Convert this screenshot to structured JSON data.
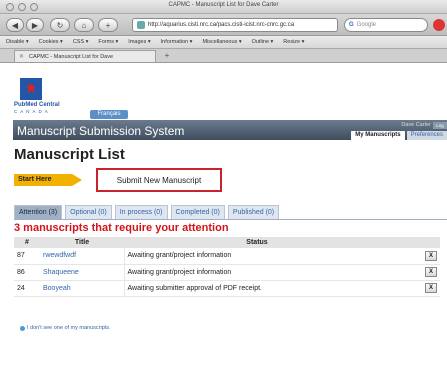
{
  "window": {
    "title": "CAPMC - Manuscript List for Dave Carter"
  },
  "toolbar": {
    "back_glyph": "◀",
    "forward_glyph": "▶",
    "reload_glyph": "↻",
    "home_glyph": "⌂",
    "add_glyph": "+",
    "url": "http://aquarius.cisti.nrc.ca/pacs.cisti-icist.nrc-cnrc.gc.ca",
    "search_placeholder": "Google",
    "search_logo": "G"
  },
  "bookmarks": [
    {
      "label": "Disable ▾"
    },
    {
      "label": "Cookies ▾"
    },
    {
      "label": "CSS ▾"
    },
    {
      "label": "Forms ▾"
    },
    {
      "label": "Images ▾"
    },
    {
      "label": "Information ▾"
    },
    {
      "label": "Miscellaneous ▾"
    },
    {
      "label": "Outline ▾"
    },
    {
      "label": "Resize ▾"
    }
  ],
  "browser_tab": {
    "label": "CAPMC - Manuscript List for Dave",
    "close_glyph": "✕",
    "new_tab_glyph": "+"
  },
  "site": {
    "logo_name": "PubMed Central",
    "logo_sub": "CANADA",
    "language_button": "Français",
    "system_title": "Manuscript Submission System",
    "user_name": "Dave Carter",
    "logout": "Log out",
    "top_tabs": [
      {
        "label": "My Manuscripts",
        "active": true
      },
      {
        "label": "Preferences",
        "active": false
      }
    ]
  },
  "page": {
    "title": "Manuscript List",
    "start_here": "Start Here",
    "submit_button": "Submit New Manuscript"
  },
  "tabs": [
    {
      "label": "Attention (3)",
      "active": true
    },
    {
      "label": "Optional (0)",
      "active": false
    },
    {
      "label": "In process (0)",
      "active": false
    },
    {
      "label": "Completed (0)",
      "active": false
    },
    {
      "label": "Published (0)",
      "active": false
    }
  ],
  "attention_heading": "3 manuscripts that require your attention",
  "table": {
    "headers": {
      "num": "#",
      "title": "Title",
      "status": "Status"
    },
    "rows": [
      {
        "num": "87",
        "title": "rwewdfwdf",
        "status": "Awaiting grant/project information",
        "action": "X"
      },
      {
        "num": "86",
        "title": "Shaqueene",
        "status": "Awaiting grant/project information",
        "action": "X"
      },
      {
        "num": "24",
        "title": "Booyeah",
        "status": "Awaiting submitter approval of PDF receipt.",
        "action": "X"
      }
    ]
  },
  "help_link": "I don't see one of my manuscripts."
}
